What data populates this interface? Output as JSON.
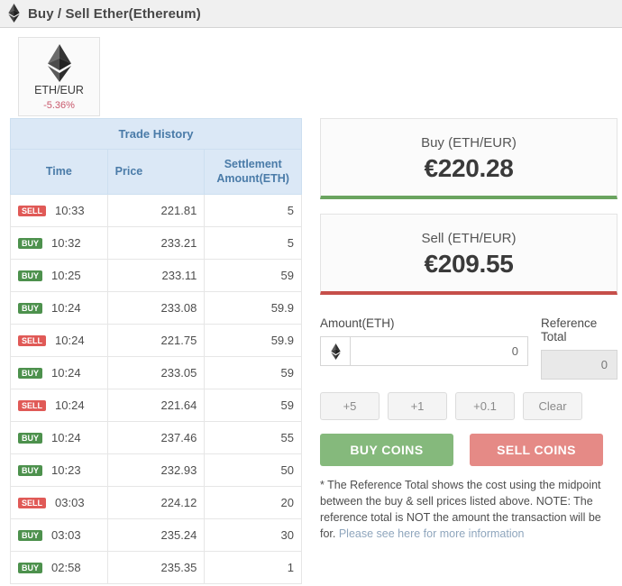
{
  "header": {
    "title": "Buy / Sell Ether(Ethereum)",
    "icon": "ethereum-icon"
  },
  "currency_tile": {
    "pair": "ETH/EUR",
    "change": "-5.36%",
    "change_color": "#c9586c",
    "icon": "ethereum-icon"
  },
  "trade_history": {
    "title": "Trade History",
    "columns": [
      "Time",
      "Price",
      "Settlement Amount(ETH)"
    ],
    "rows": [
      {
        "side": "SELL",
        "time": "10:33",
        "price": "221.81",
        "amount": "5"
      },
      {
        "side": "BUY",
        "time": "10:32",
        "price": "233.21",
        "amount": "5"
      },
      {
        "side": "BUY",
        "time": "10:25",
        "price": "233.11",
        "amount": "59"
      },
      {
        "side": "BUY",
        "time": "10:24",
        "price": "233.08",
        "amount": "59.9"
      },
      {
        "side": "SELL",
        "time": "10:24",
        "price": "221.75",
        "amount": "59.9"
      },
      {
        "side": "BUY",
        "time": "10:24",
        "price": "233.05",
        "amount": "59"
      },
      {
        "side": "SELL",
        "time": "10:24",
        "price": "221.64",
        "amount": "59"
      },
      {
        "side": "BUY",
        "time": "10:24",
        "price": "237.46",
        "amount": "55"
      },
      {
        "side": "BUY",
        "time": "10:23",
        "price": "232.93",
        "amount": "50"
      },
      {
        "side": "SELL",
        "time": "03:03",
        "price": "224.12",
        "amount": "20"
      },
      {
        "side": "BUY",
        "time": "03:03",
        "price": "235.24",
        "amount": "30"
      },
      {
        "side": "BUY",
        "time": "02:58",
        "price": "235.35",
        "amount": "1"
      }
    ],
    "badge_colors": {
      "buy": "#4d914d",
      "sell": "#e05a57"
    }
  },
  "buy_card": {
    "label": "Buy (ETH/EUR)",
    "value": "€220.28",
    "accent": "#6aa45f"
  },
  "sell_card": {
    "label": "Sell (ETH/EUR)",
    "value": "€209.55",
    "accent": "#c64f4a"
  },
  "amount_field": {
    "label": "Amount(ETH)",
    "addon_icon": "ethereum-icon",
    "value": "0",
    "placeholder": "0"
  },
  "reference_field": {
    "label": "Reference Total",
    "value": "0",
    "placeholder": "0"
  },
  "quick_buttons": [
    {
      "label": "+5"
    },
    {
      "label": "+1"
    },
    {
      "label": "+0.1"
    },
    {
      "label": "Clear"
    }
  ],
  "actions": {
    "buy_label": "BUY COINS",
    "sell_label": "SELL COINS",
    "buy_color": "#85b97c",
    "sell_color": "#e58a86"
  },
  "note": {
    "text": "* The Reference Total shows the cost using the midpoint between the buy & sell prices listed above. NOTE: The reference total is NOT the amount the transaction will be for. ",
    "link_text": "Please see here for more information",
    "link_color": "#8fa6bd"
  }
}
